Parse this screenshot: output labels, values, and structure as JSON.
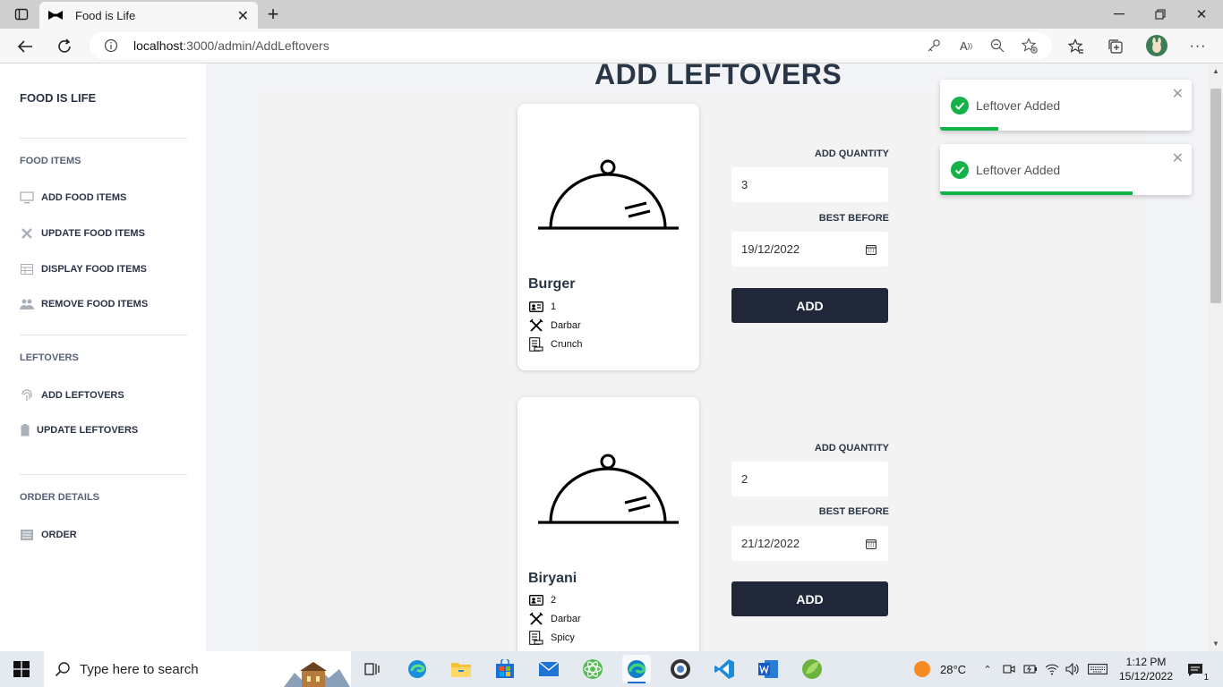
{
  "browser": {
    "tab_title": "Food is Life",
    "url_host": "localhost",
    "url_rest": ":3000/admin/AddLeftovers"
  },
  "sidebar": {
    "brand": "FOOD IS LIFE",
    "sections": [
      {
        "title": "FOOD ITEMS",
        "items": [
          {
            "label": "ADD FOOD ITEMS",
            "icon": "monitor-icon"
          },
          {
            "label": "UPDATE FOOD ITEMS",
            "icon": "tools-icon"
          },
          {
            "label": "DISPLAY FOOD ITEMS",
            "icon": "table-icon"
          },
          {
            "label": "REMOVE FOOD ITEMS",
            "icon": "people-icon"
          }
        ]
      },
      {
        "title": "LEFTOVERS",
        "items": [
          {
            "label": "ADD LEFTOVERS",
            "icon": "fingerprint-icon"
          },
          {
            "label": "UPDATE LEFTOVERS",
            "icon": "clipboard-icon"
          }
        ]
      },
      {
        "title": "ORDER DETAILS",
        "items": [
          {
            "label": "ORDER",
            "icon": "list-icon"
          }
        ]
      }
    ]
  },
  "page": {
    "title": "ADD LEFTOVERS"
  },
  "items": [
    {
      "name": "Burger",
      "id": "1",
      "restaurant": "Darbar",
      "description": "Crunch",
      "quantity_label": "ADD QUANTITY",
      "quantity": "3",
      "best_before_label": "BEST BEFORE",
      "best_before": "19/12/2022",
      "button": "ADD"
    },
    {
      "name": "Biryani",
      "id": "2",
      "restaurant": "Darbar",
      "description": "Spicy",
      "quantity_label": "ADD QUANTITY",
      "quantity": "2",
      "best_before_label": "BEST BEFORE",
      "best_before": "21/12/2022",
      "button": "ADD"
    }
  ],
  "toasts": [
    {
      "message": "Leftover Added",
      "progress": 0.23
    },
    {
      "message": "Leftover Added",
      "progress": 0.765
    }
  ],
  "taskbar": {
    "search_placeholder": "Type here to search",
    "temperature": "28°C",
    "time": "1:12 PM",
    "date": "15/12/2022",
    "notifications": "1"
  },
  "colors": {
    "accent": "#1f2739",
    "title": "#283646",
    "success": "#15b24a"
  }
}
